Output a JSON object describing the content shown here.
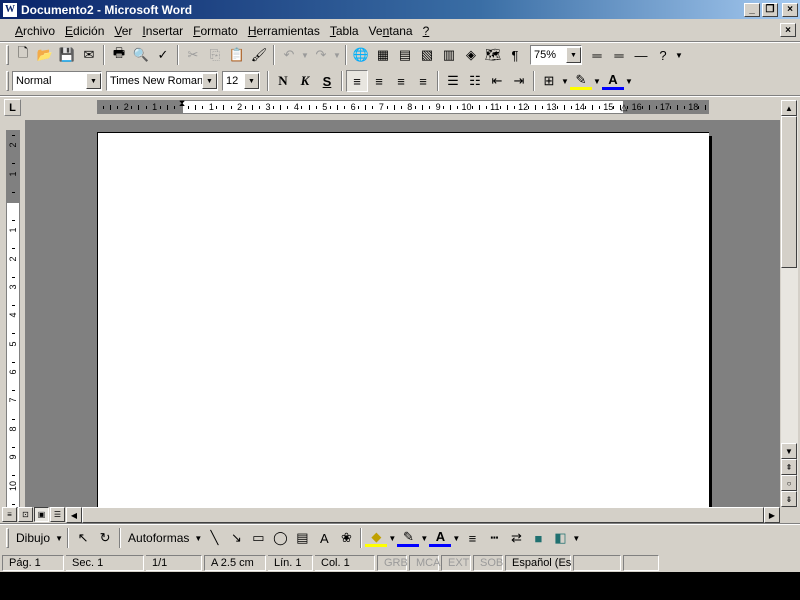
{
  "window": {
    "title": "Documento2 - Microsoft Word",
    "app_icon": "W",
    "minimize_glyph": "_",
    "restore_glyph": "❐",
    "close_glyph": "×"
  },
  "menu": {
    "items": [
      "Archivo",
      "Edición",
      "Ver",
      "Insertar",
      "Formato",
      "Herramientas",
      "Tabla",
      "Ventana",
      "?"
    ],
    "underline": [
      "A",
      "E",
      "V",
      "I",
      "F",
      "H",
      "T",
      "n",
      "?"
    ]
  },
  "standard_toolbar": {
    "buttons": [
      {
        "name": "new-document-icon",
        "glyph": "🗋",
        "state": "enabled"
      },
      {
        "name": "open-icon",
        "glyph": "📂",
        "state": "enabled"
      },
      {
        "name": "save-icon",
        "glyph": "💾",
        "state": "enabled"
      },
      {
        "name": "email-icon",
        "glyph": "✉",
        "state": "enabled"
      },
      {
        "name": "print-icon",
        "glyph": "🖶",
        "state": "enabled"
      },
      {
        "name": "print-preview-icon",
        "glyph": "🔍",
        "state": "enabled"
      },
      {
        "name": "spelling-icon",
        "glyph": "✓",
        "state": "enabled"
      },
      {
        "name": "cut-icon",
        "glyph": "✂",
        "state": "disabled"
      },
      {
        "name": "copy-icon",
        "glyph": "⎘",
        "state": "disabled"
      },
      {
        "name": "paste-icon",
        "glyph": "📋",
        "state": "enabled"
      },
      {
        "name": "format-painter-icon",
        "glyph": "🖌",
        "state": "enabled"
      },
      {
        "name": "undo-icon",
        "glyph": "↶",
        "state": "disabled"
      },
      {
        "name": "redo-icon",
        "glyph": "↷",
        "state": "disabled"
      },
      {
        "name": "hyperlink-icon",
        "glyph": "🌐",
        "state": "enabled"
      },
      {
        "name": "tables-borders-icon",
        "glyph": "▦",
        "state": "enabled"
      },
      {
        "name": "insert-table-icon",
        "glyph": "▤",
        "state": "enabled"
      },
      {
        "name": "insert-excel-icon",
        "glyph": "▧",
        "state": "enabled"
      },
      {
        "name": "columns-icon",
        "glyph": "▥",
        "state": "enabled"
      },
      {
        "name": "drawing-icon",
        "glyph": "◈",
        "state": "enabled"
      },
      {
        "name": "document-map-icon",
        "glyph": "🗺",
        "state": "enabled"
      },
      {
        "name": "show-hide-icon",
        "glyph": "¶",
        "state": "enabled"
      }
    ],
    "zoom": "75%",
    "extra_buttons": [
      {
        "name": "line-style-icon",
        "glyph": "═"
      },
      {
        "name": "line-style-2-icon",
        "glyph": "═"
      },
      {
        "name": "line-icon",
        "glyph": "—"
      },
      {
        "name": "help-icon",
        "glyph": "?"
      }
    ]
  },
  "formatting_toolbar": {
    "style": "Normal",
    "font": "Times New Roman",
    "size": "12",
    "bold": "N",
    "italic": "K",
    "underline": "S",
    "align_buttons": [
      {
        "name": "align-left-icon",
        "glyph": "≡",
        "active": true
      },
      {
        "name": "align-center-icon",
        "glyph": "≡",
        "active": false
      },
      {
        "name": "align-right-icon",
        "glyph": "≡",
        "active": false
      },
      {
        "name": "justify-icon",
        "glyph": "≡",
        "active": false
      }
    ],
    "list_buttons": [
      {
        "name": "numbering-icon",
        "glyph": "☰"
      },
      {
        "name": "bullets-icon",
        "glyph": "☷"
      },
      {
        "name": "decrease-indent-icon",
        "glyph": "⇤"
      },
      {
        "name": "increase-indent-icon",
        "glyph": "⇥"
      }
    ],
    "border_glyph": "⊞",
    "highlight_glyph": "✎",
    "font_color_glyph": "A"
  },
  "ruler": {
    "tab_selector": "L",
    "left_numbers": [
      "3",
      "2",
      "1"
    ],
    "numbers": [
      "1",
      "2",
      "3",
      "4",
      "5",
      "6",
      "7",
      "8",
      "9",
      "10",
      "11",
      "12",
      "13",
      "14",
      "15",
      "16",
      "17",
      "18"
    ],
    "vertical_top_numbers": [
      "2",
      "1"
    ],
    "vertical_numbers": [
      "1",
      "2",
      "3",
      "4",
      "5",
      "6",
      "7",
      "8",
      "9",
      "10"
    ]
  },
  "scrollbar": {
    "up": "▲",
    "down": "▼",
    "prev_page": "⇞",
    "select_browse": "○",
    "next_page": "⇟",
    "left": "◀",
    "right": "▶",
    "view_buttons": [
      {
        "name": "normal-view-button",
        "glyph": "≡"
      },
      {
        "name": "web-layout-view-button",
        "glyph": "⊡"
      },
      {
        "name": "print-layout-view-button",
        "glyph": "▣",
        "active": true
      },
      {
        "name": "outline-view-button",
        "glyph": "☰"
      }
    ]
  },
  "drawing_toolbar": {
    "draw_label": "Dibujo",
    "autoshapes_label": "Autoformas",
    "buttons": [
      {
        "name": "select-objects-icon",
        "glyph": "↖"
      },
      {
        "name": "free-rotate-icon",
        "glyph": "↻"
      },
      {
        "name": "line-tool-icon",
        "glyph": "╲"
      },
      {
        "name": "arrow-tool-icon",
        "glyph": "↘"
      },
      {
        "name": "rectangle-tool-icon",
        "glyph": "▭"
      },
      {
        "name": "oval-tool-icon",
        "glyph": "◯"
      },
      {
        "name": "text-box-icon",
        "glyph": "▤"
      },
      {
        "name": "wordart-icon",
        "glyph": "A"
      },
      {
        "name": "clipart-icon",
        "glyph": "❀"
      },
      {
        "name": "fill-color-icon",
        "glyph": "◆"
      },
      {
        "name": "line-color-icon",
        "glyph": "✎"
      },
      {
        "name": "font-color-draw-icon",
        "glyph": "A"
      },
      {
        "name": "line-style-draw-icon",
        "glyph": "≡"
      },
      {
        "name": "dash-style-icon",
        "glyph": "┅"
      },
      {
        "name": "arrow-style-icon",
        "glyph": "⇄"
      },
      {
        "name": "shadow-icon",
        "glyph": "■"
      },
      {
        "name": "3d-icon",
        "glyph": "◧"
      }
    ]
  },
  "status": {
    "page": "Pág. 1",
    "section": "Sec. 1",
    "page_of": "1/1",
    "position": "A  2.5 cm",
    "line": "Lín. 1",
    "column": "Col. 1",
    "rec": "GRB",
    "trk": "MCA",
    "ext": "EXT",
    "ovr": "SOB",
    "language": "Español (Es"
  }
}
